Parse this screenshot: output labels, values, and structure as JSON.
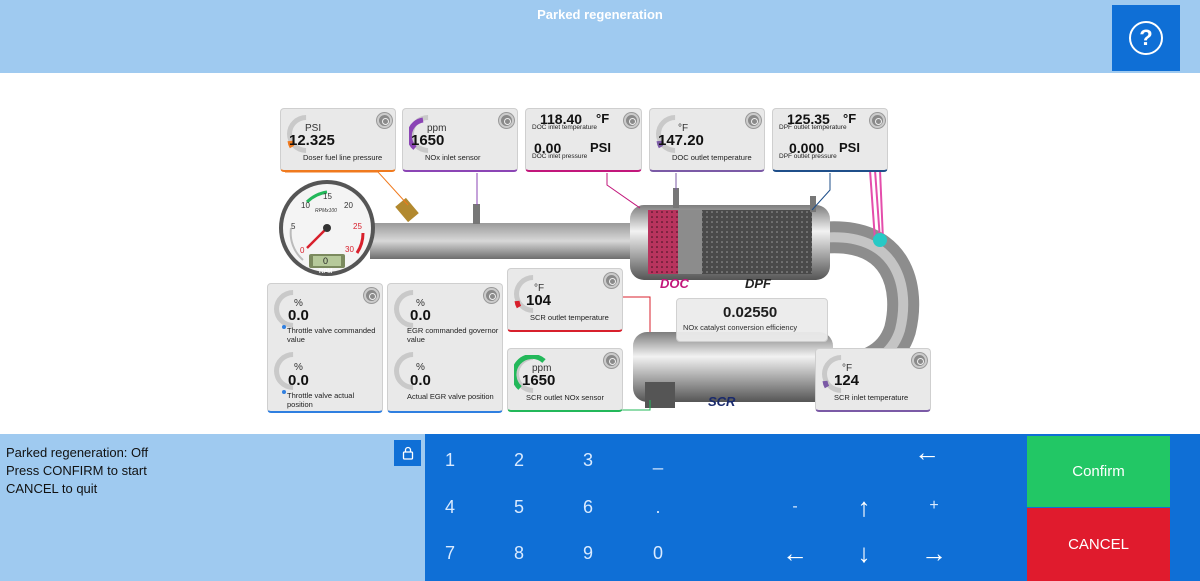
{
  "header": {
    "title": "Parked regeneration",
    "help_label": "?"
  },
  "cards": {
    "doser": {
      "unit": "PSI",
      "value": "12.325",
      "label": "Doser fuel line pressure",
      "accent": "#f07a1e",
      "level": 0.4
    },
    "nox_in": {
      "unit": "ppm",
      "value": "1650",
      "label": "NOx inlet sensor",
      "accent": "#8b45b5",
      "level": 0.75
    },
    "doc_in": {
      "temp_value": "118.40",
      "temp_unit": "°F",
      "temp_label": "DOC inlet temperature",
      "pres_value": "0.00",
      "pres_unit": "PSI",
      "pres_label": "DOC inlet pressure",
      "accent": "#c2177b"
    },
    "doc_out": {
      "unit": "°F",
      "value": "147.20",
      "label": "DOC outlet temperature",
      "accent": "#7b5aa6"
    },
    "dpf_out": {
      "temp_value": "125.35",
      "temp_unit": "°F",
      "temp_label": "DPF outlet temperature",
      "pres_value": "0.000",
      "pres_unit": "PSI",
      "pres_label": "DPF outlet pressure",
      "accent": "#1f4f8a"
    },
    "throttle_cmd": {
      "unit": "%",
      "value": "0.0",
      "label": "Throttle valve commanded value",
      "accent": "#2f7fe0"
    },
    "throttle_act": {
      "unit": "%",
      "value": "0.0",
      "label": "Throttle valve actual position",
      "accent": "#2f7fe0"
    },
    "egr_cmd": {
      "unit": "%",
      "value": "0.0",
      "label": "EGR commanded governor value",
      "accent": "#2f7fe0"
    },
    "egr_act": {
      "unit": "%",
      "value": "0.0",
      "label": "Actual EGR valve position",
      "accent": "#2f7fe0"
    },
    "scr_out": {
      "unit": "°F",
      "value": "104",
      "label": "SCR outlet temperature",
      "accent": "#d8202c"
    },
    "scr_nox": {
      "unit": "ppm",
      "value": "1650",
      "label": "SCR outlet NOx sensor",
      "accent": "#23b85a",
      "level": 0.75
    },
    "scr_in": {
      "unit": "°F",
      "value": "124",
      "label": "SCR inlet temperature",
      "accent": "#7b5aa6"
    },
    "nox_eff": {
      "value": "0.02550",
      "label": "NOx catalyst conversion efficiency"
    }
  },
  "tach": {
    "ticks": [
      "0",
      "5",
      "10",
      "15",
      "20",
      "25",
      "30"
    ],
    "scale": "RPMx100",
    "readout": "0",
    "label": "RPM"
  },
  "components": {
    "doc": "DOC",
    "dpf": "DPF",
    "scr": "SCR"
  },
  "status": {
    "line1": "Parked regeneration: Off",
    "line2": "Press CONFIRM to start",
    "line3": "CANCEL to quit"
  },
  "keypad": {
    "digits": [
      "1",
      "2",
      "3",
      "_",
      "4",
      "5",
      "6",
      ".",
      "7",
      "8",
      "9",
      "0"
    ],
    "minus": "-",
    "plus": "+",
    "backspace": "←",
    "up": "↑",
    "down": "↓",
    "left": "←",
    "right": "→"
  },
  "actions": {
    "confirm": "Confirm",
    "cancel": "CANCEL"
  }
}
